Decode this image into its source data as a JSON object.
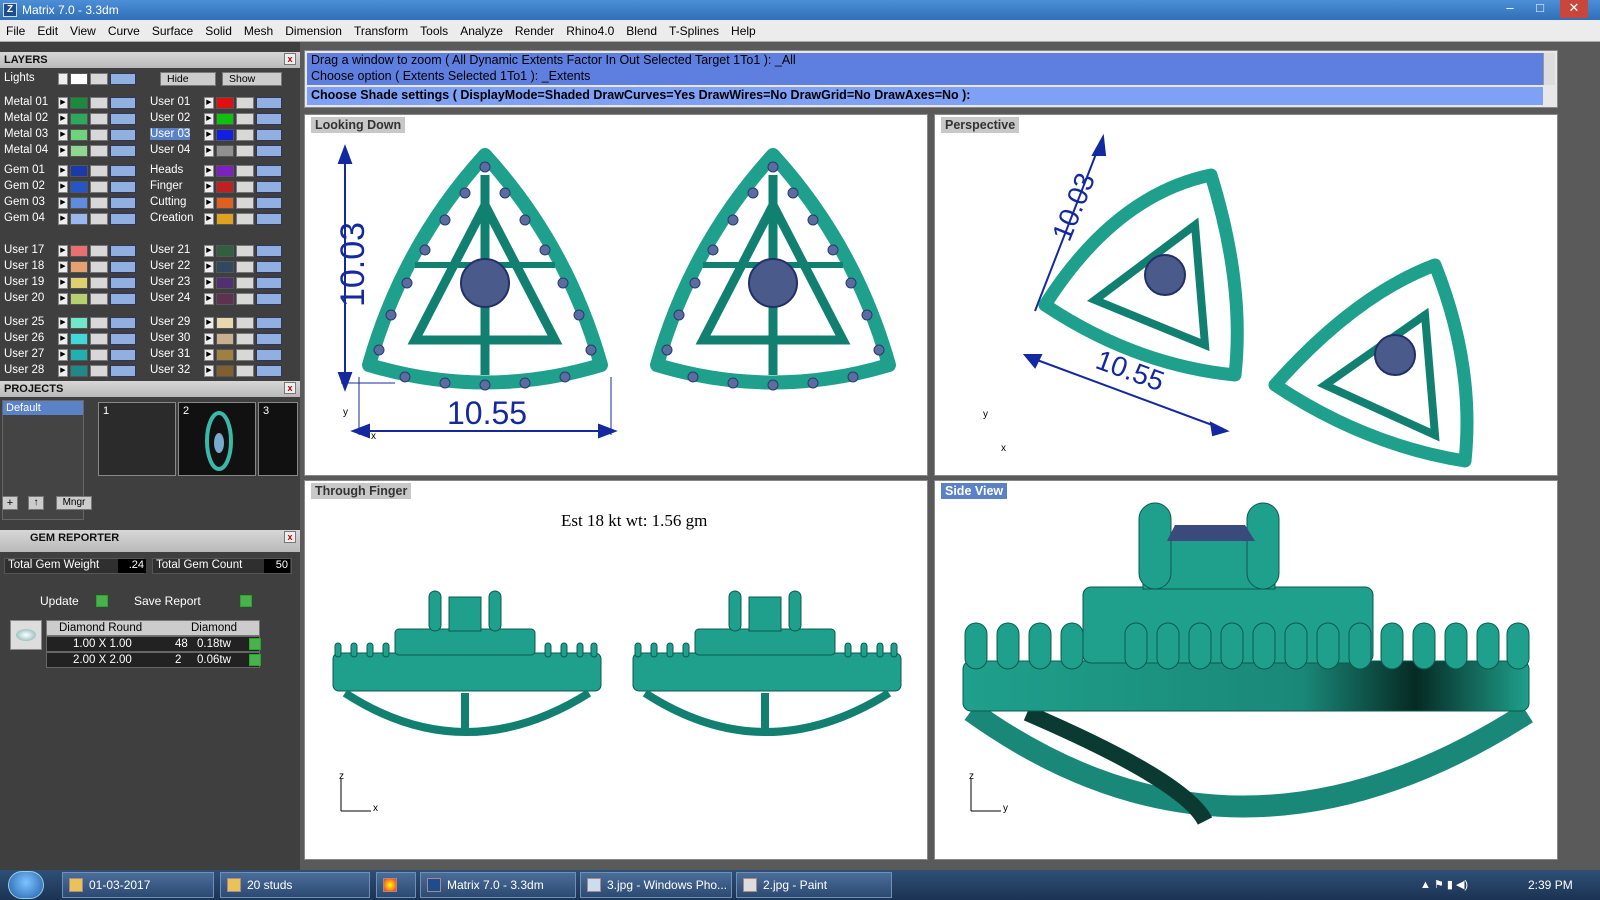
{
  "window": {
    "title": "Matrix 7.0 - 3.3dm",
    "min": "–",
    "max": "□",
    "close": "✕"
  },
  "menu": [
    "File",
    "Edit",
    "View",
    "Curve",
    "Surface",
    "Solid",
    "Mesh",
    "Dimension",
    "Transform",
    "Tools",
    "Analyze",
    "Render",
    "Rhino4.0",
    "Blend",
    "T-Splines",
    "Help"
  ],
  "layers": {
    "title": "LAYERS",
    "lights": "Lights",
    "hide": "Hide",
    "show": "Show",
    "left": [
      {
        "name": "Metal 01",
        "color": "#1a8a3c"
      },
      {
        "name": "Metal 02",
        "color": "#2ea85a"
      },
      {
        "name": "Metal 03",
        "color": "#6ed37a"
      },
      {
        "name": "Metal 04",
        "color": "#8fd68f"
      },
      {
        "name": "Gem 01",
        "color": "#1a3aa8"
      },
      {
        "name": "Gem 02",
        "color": "#2456c8"
      },
      {
        "name": "Gem 03",
        "color": "#5e8de0"
      },
      {
        "name": "Gem 04",
        "color": "#9ab8f0"
      },
      {
        "name": "User 17",
        "color": "#e87070"
      },
      {
        "name": "User 18",
        "color": "#e8a070"
      },
      {
        "name": "User 19",
        "color": "#e0d070"
      },
      {
        "name": "User 20",
        "color": "#b8d070"
      },
      {
        "name": "User 25",
        "color": "#70e8c8"
      },
      {
        "name": "User 26",
        "color": "#40d8d8"
      },
      {
        "name": "User 27",
        "color": "#20b0b0"
      },
      {
        "name": "User 28",
        "color": "#208888"
      }
    ],
    "right": [
      {
        "name": "User 01",
        "color": "#e01010"
      },
      {
        "name": "User 02",
        "color": "#10c010"
      },
      {
        "name": "User 03",
        "color": "#1020e0"
      },
      {
        "name": "User 04",
        "color": "#909090"
      },
      {
        "name": "Heads",
        "color": "#8020c0"
      },
      {
        "name": "Finger",
        "color": "#c02020"
      },
      {
        "name": "Cutting",
        "color": "#e06020"
      },
      {
        "name": "Creation",
        "color": "#e0a020"
      },
      {
        "name": "User 21",
        "color": "#306040"
      },
      {
        "name": "User 22",
        "color": "#304860"
      },
      {
        "name": "User 23",
        "color": "#503070"
      },
      {
        "name": "User 24",
        "color": "#603050"
      },
      {
        "name": "User 29",
        "color": "#e8d8b0"
      },
      {
        "name": "User 30",
        "color": "#c8b090"
      },
      {
        "name": "User 31",
        "color": "#a08040"
      },
      {
        "name": "User 32",
        "color": "#806030"
      }
    ]
  },
  "projects": {
    "title": "PROJECTS",
    "default": "Default",
    "slots": [
      "1",
      "2",
      "3"
    ],
    "mngr": "Mngr"
  },
  "gem_reporter": {
    "title": "GEM REPORTER",
    "weight_label": "Total Gem Weight",
    "weight": ".24",
    "count_label": "Total Gem Count",
    "count": "50",
    "update": "Update",
    "save": "Save Report",
    "head1": "Diamond Round",
    "head2": "Diamond",
    "rows": [
      {
        "size": "1.00 X 1.00",
        "qty": "48",
        "tw": "0.18tw"
      },
      {
        "size": "2.00 X 2.00",
        "qty": "2",
        "tw": "0.06tw"
      }
    ]
  },
  "command": {
    "line1": "Drag a window to zoom ( All  Dynamic  Extents  Factor  In  Out  Selected  Target  1To1 ): _All",
    "line2": "Choose option ( Extents  Selected  1To1 ): _Extents",
    "line3": "Choose Shade settings ( DisplayMode=Shaded  DrawCurves=Yes  DrawWires=No  DrawGrid=No  DrawAxes=No ):"
  },
  "viewports": {
    "top_left": "Looking Down",
    "top_right": "Perspective",
    "bottom_left": "Through Finger",
    "bottom_right": "Side View",
    "dim_h": "10.03",
    "dim_w": "10.55",
    "weight_note": "Est 18 kt wt: 1.56 gm"
  },
  "axes": {
    "x": "x",
    "y": "y",
    "z": "z"
  },
  "taskbar": {
    "items": [
      "01-03-2017",
      "20 studs",
      "Matrix 7.0 - 3.3dm",
      "3.jpg - Windows Pho...",
      "2.jpg - Paint"
    ],
    "time": "2:39 PM"
  },
  "colors": {
    "metal": "#1fa08c",
    "metal_dark": "#0b5a4e",
    "gem": "#4a5a8a"
  }
}
